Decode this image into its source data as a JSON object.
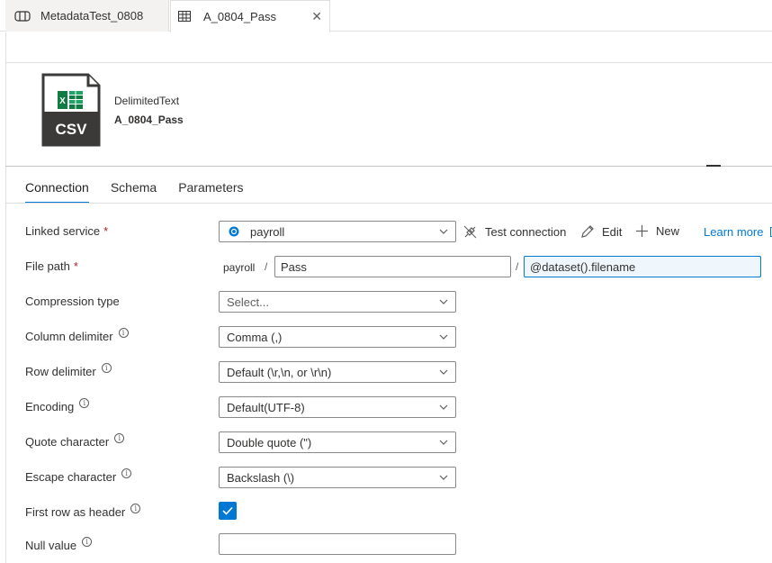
{
  "tabs": [
    {
      "label": "MetadataTest_0808",
      "icon": "pipeline-icon"
    },
    {
      "label": "A_0804_Pass",
      "icon": "table-icon",
      "close": "✕"
    }
  ],
  "dataset": {
    "icon_text": "CSV",
    "type": "DelimitedText",
    "name": "A_0804_Pass"
  },
  "subtabs": [
    "Connection",
    "Schema",
    "Parameters"
  ],
  "form": {
    "linked_service": {
      "label": "Linked service",
      "required": "*",
      "value": "payroll"
    },
    "actions": {
      "test": "Test connection",
      "edit": "Edit",
      "new": "New",
      "learn": "Learn more"
    },
    "file_path": {
      "label": "File path",
      "required": "*",
      "container": "payroll",
      "sep1": "/",
      "directory": "Pass",
      "sep2": "/",
      "file": "@dataset().filename"
    },
    "compression": {
      "label": "Compression type",
      "value": "Select..."
    },
    "column_delimiter": {
      "label": "Column delimiter",
      "value": "Comma (,)"
    },
    "row_delimiter": {
      "label": "Row delimiter",
      "value": "Default (\\r,\\n, or \\r\\n)"
    },
    "encoding": {
      "label": "Encoding",
      "value": "Default(UTF-8)"
    },
    "quote_char": {
      "label": "Quote character",
      "value": "Double quote (\")"
    },
    "escape_char": {
      "label": "Escape character",
      "value": "Backslash (\\)"
    },
    "first_row_header": {
      "label": "First row as header",
      "checked": true
    },
    "null_value": {
      "label": "Null value",
      "value": ""
    }
  },
  "colors": {
    "accent": "#0078d4",
    "required": "#a4262c",
    "csv_green": "#107c41"
  }
}
